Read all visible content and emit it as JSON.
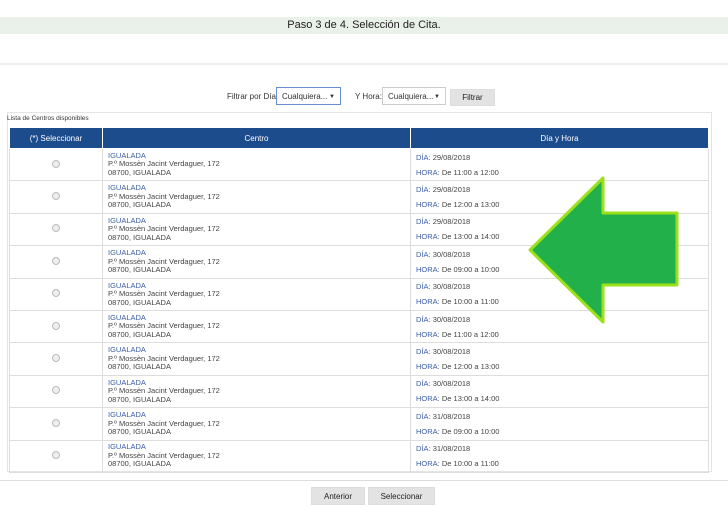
{
  "header": {
    "step": "Paso 3 de 4. Selección de Cita."
  },
  "filter": {
    "day_label": "Filtrar por Día:",
    "day_value": "Cualquiera...",
    "hour_label": "Y Hora:",
    "hour_value": "Cualquiera...",
    "button": "Filtrar"
  },
  "list": {
    "title": "Lista de Centros disponibles",
    "columns": [
      "(*) Seleccionar",
      "Centro",
      "Día y Hora"
    ],
    "day_prefix": "DÍA:",
    "hour_prefix": "HORA:",
    "rows": [
      {
        "city": "IGUALADA",
        "address": "P.º Mossèn Jacint Verdaguer, 172",
        "postal": "08700, IGUALADA",
        "day": "29/08/2018",
        "hour": "De 11:00 a 12:00"
      },
      {
        "city": "IGUALADA",
        "address": "P.º Mossèn Jacint Verdaguer, 172",
        "postal": "08700, IGUALADA",
        "day": "29/08/2018",
        "hour": "De 12:00 a 13:00"
      },
      {
        "city": "IGUALADA",
        "address": "P.º Mossèn Jacint Verdaguer, 172",
        "postal": "08700, IGUALADA",
        "day": "29/08/2018",
        "hour": "De 13:00 a 14:00"
      },
      {
        "city": "IGUALADA",
        "address": "P.º Mossèn Jacint Verdaguer, 172",
        "postal": "08700, IGUALADA",
        "day": "30/08/2018",
        "hour": "De 09:00 a 10:00"
      },
      {
        "city": "IGUALADA",
        "address": "P.º Mossèn Jacint Verdaguer, 172",
        "postal": "08700, IGUALADA",
        "day": "30/08/2018",
        "hour": "De 10:00 a 11:00"
      },
      {
        "city": "IGUALADA",
        "address": "P.º Mossèn Jacint Verdaguer, 172",
        "postal": "08700, IGUALADA",
        "day": "30/08/2018",
        "hour": "De 11:00 a 12:00"
      },
      {
        "city": "IGUALADA",
        "address": "P.º Mossèn Jacint Verdaguer, 172",
        "postal": "08700, IGUALADA",
        "day": "30/08/2018",
        "hour": "De 12:00 a 13:00"
      },
      {
        "city": "IGUALADA",
        "address": "P.º Mossèn Jacint Verdaguer, 172",
        "postal": "08700, IGUALADA",
        "day": "30/08/2018",
        "hour": "De 13:00 a 14:00"
      },
      {
        "city": "IGUALADA",
        "address": "P.º Mossèn Jacint Verdaguer, 172",
        "postal": "08700, IGUALADA",
        "day": "31/08/2018",
        "hour": "De 09:00 a 10:00"
      },
      {
        "city": "IGUALADA",
        "address": "P.º Mossèn Jacint Verdaguer, 172",
        "postal": "08700, IGUALADA",
        "day": "31/08/2018",
        "hour": "De 10:00 a 11:00"
      }
    ]
  },
  "footer": {
    "back": "Anterior",
    "select": "Seleccionar"
  },
  "colors": {
    "header_blue": "#1d4c8c",
    "arrow_green": "#22b04a",
    "arrow_outline": "#9be01a"
  }
}
